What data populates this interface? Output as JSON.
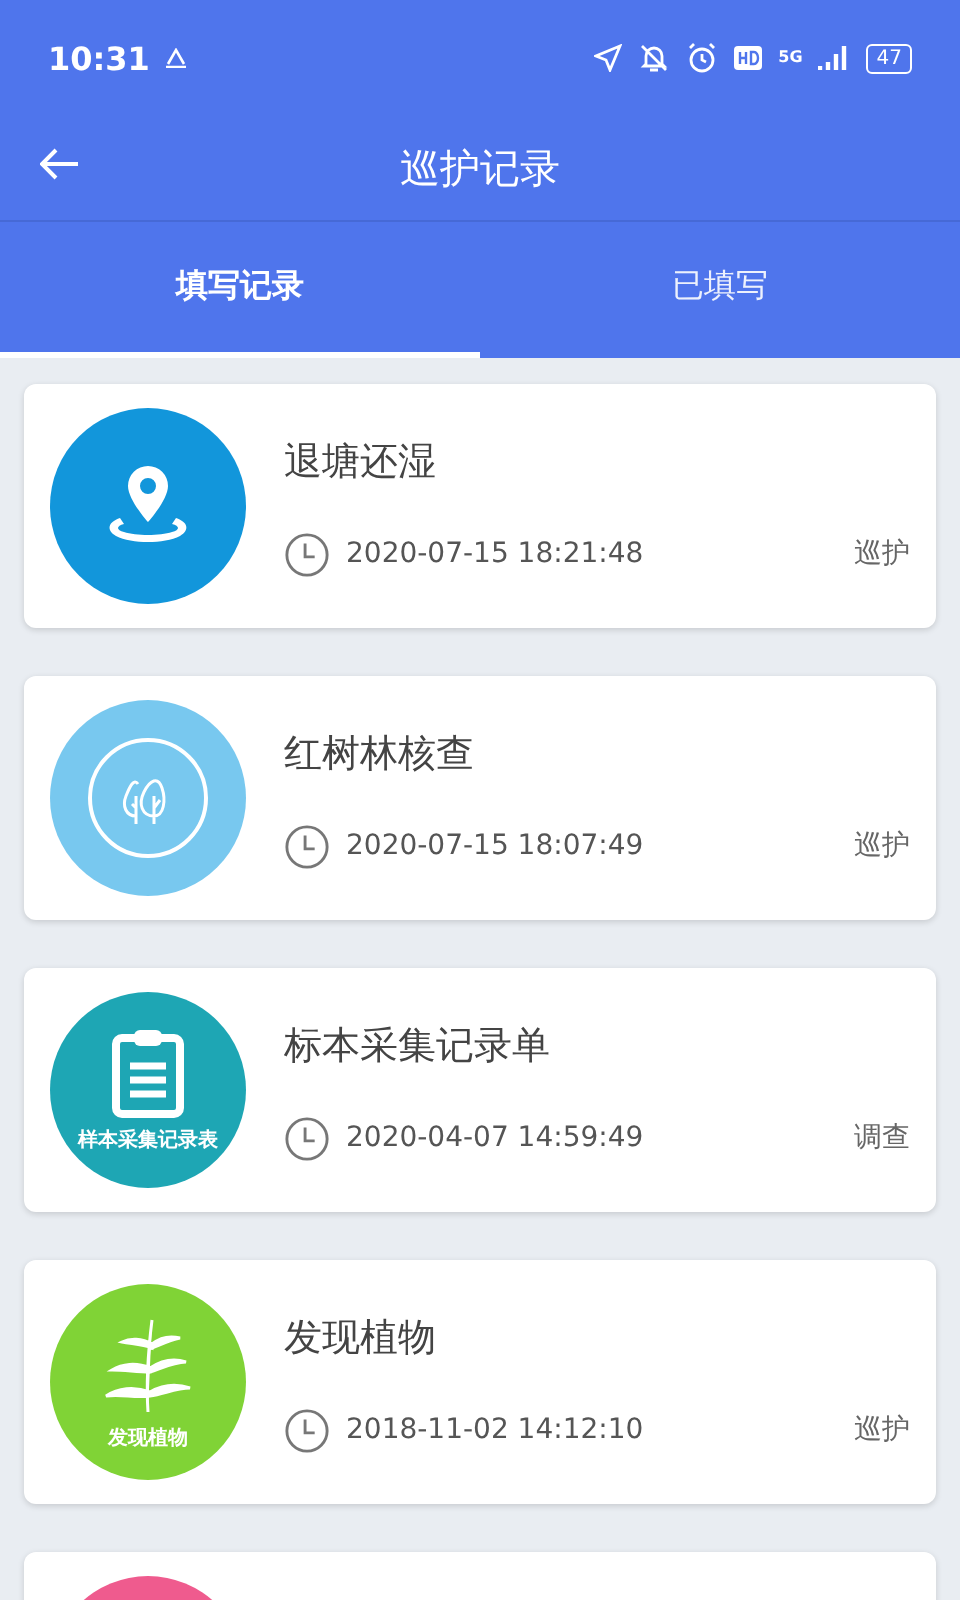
{
  "status_bar": {
    "time": "10:31",
    "network": "5G",
    "battery": "47"
  },
  "header": {
    "title": "巡护记录"
  },
  "tabs": [
    {
      "label": "填写记录",
      "selected": true
    },
    {
      "label": "已填写",
      "selected": false
    }
  ],
  "records": [
    {
      "kind": "pin",
      "color": "#1296db",
      "title": "退塘还湿",
      "time": "2020-07-15 18:21:48",
      "type": "巡护"
    },
    {
      "kind": "trees",
      "color": "#78c8ef",
      "title": "红树林核查",
      "time": "2020-07-15 18:07:49",
      "type": "巡护"
    },
    {
      "kind": "clipboard",
      "color": "#1ea6b4",
      "caption": "样本采集记录表",
      "title": "标本采集记录单",
      "time": "2020-04-07 14:59:49",
      "type": "调查"
    },
    {
      "kind": "leaf",
      "color": "#80d336",
      "caption": "发现植物",
      "title": "发现植物",
      "time": "2018-11-02 14:12:10",
      "type": "巡护"
    },
    {
      "kind": "blank",
      "color": "#ef5b8e"
    }
  ]
}
